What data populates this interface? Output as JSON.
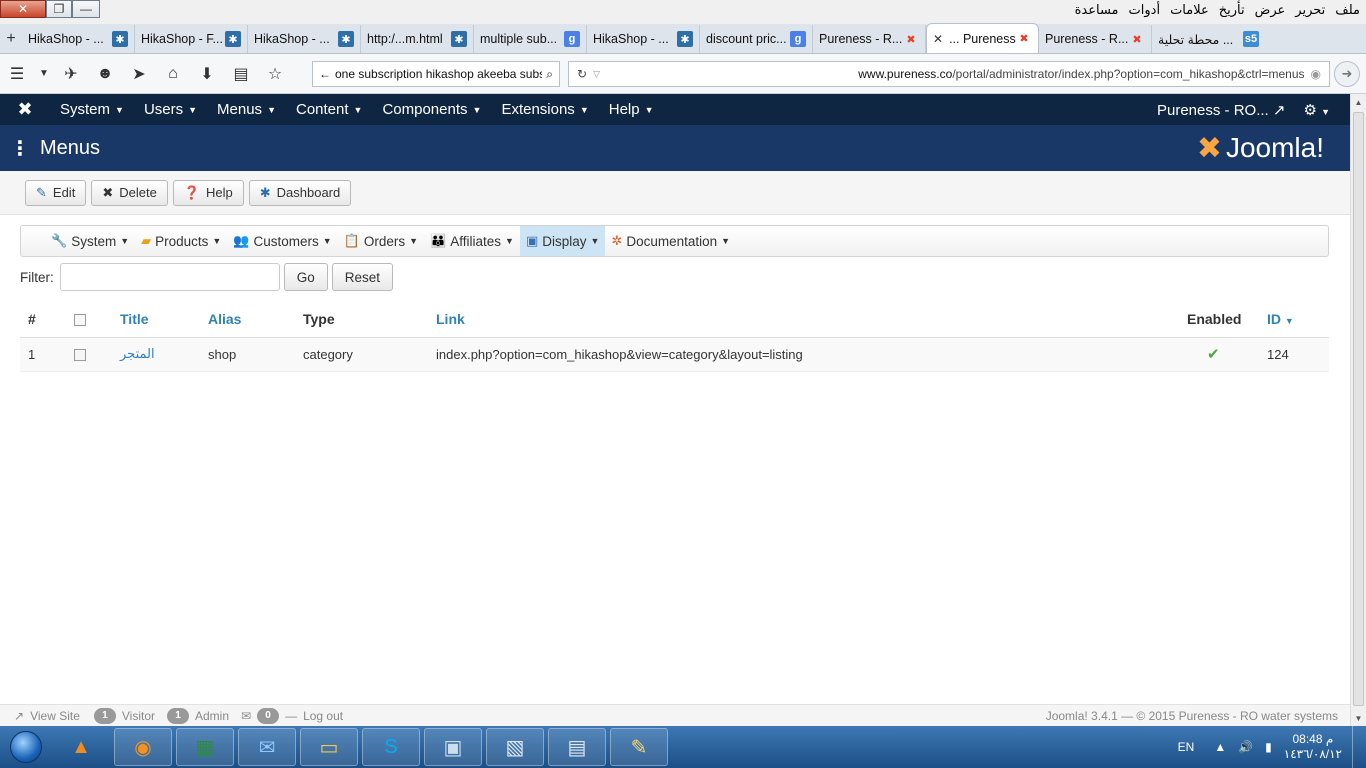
{
  "browser": {
    "menu_items_ar": [
      "ملف",
      "تحرير",
      "عرض",
      "تأريخ",
      "علامات",
      "أدوات",
      "مساعدة"
    ],
    "tabs": [
      {
        "label": "HikaShop - ...",
        "icon": "hikashop-icon"
      },
      {
        "label": "HikaShop - F...",
        "icon": "hikashop-icon"
      },
      {
        "label": "HikaShop - ...",
        "icon": "hikashop-icon"
      },
      {
        "label": "http:/...m.html",
        "icon": "hikashop-icon"
      },
      {
        "label": "multiple sub...",
        "icon": "google-icon"
      },
      {
        "label": "HikaShop - ...",
        "icon": "hikashop-icon"
      },
      {
        "label": "discount pric...",
        "icon": "google-icon"
      },
      {
        "label": "Pureness - R...",
        "icon": "joomla-icon"
      },
      {
        "label": "... Pureness",
        "icon": "joomla-icon",
        "active": true
      },
      {
        "label": "Pureness - R...",
        "icon": "joomla-icon"
      },
      {
        "label": "محطة تحلية ...",
        "icon": "s5-icon"
      }
    ],
    "search_value": "one subscription hikashop akeeba subs",
    "url_host": "www.pureness.co",
    "url_path": "/portal/administrator/index.php?option=com_hikashop&ctrl=menus"
  },
  "joomla": {
    "nav": [
      "System",
      "Users",
      "Menus",
      "Content",
      "Components",
      "Extensions",
      "Help"
    ],
    "site_name": "Pureness - RO...",
    "page_title": "Menus",
    "brand": "Joomla!",
    "toolbar": {
      "edit": "Edit",
      "delete": "Delete",
      "help": "Help",
      "dashboard": "Dashboard"
    },
    "hikamenu": [
      {
        "label": "System",
        "icon": "wrench-icon"
      },
      {
        "label": "Products",
        "icon": "box-icon"
      },
      {
        "label": "Customers",
        "icon": "users-icon"
      },
      {
        "label": "Orders",
        "icon": "orders-icon"
      },
      {
        "label": "Affiliates",
        "icon": "affiliates-icon"
      },
      {
        "label": "Display",
        "icon": "display-icon",
        "active": true
      },
      {
        "label": "Documentation",
        "icon": "lifebuoy-icon"
      }
    ],
    "filter": {
      "label": "Filter:",
      "value": "",
      "go": "Go",
      "reset": "Reset"
    },
    "table": {
      "headers": {
        "num": "#",
        "title": "Title",
        "alias": "Alias",
        "type": "Type",
        "link": "Link",
        "enabled": "Enabled",
        "id": "ID"
      },
      "rows": [
        {
          "num": "1",
          "title": "المتجر",
          "alias": "shop",
          "type": "category",
          "link": "index.php?option=com_hikashop&view=category&layout=listing",
          "enabled": true,
          "id": "124"
        }
      ]
    },
    "footer": {
      "view_site": "View Site",
      "visitors_count": "1",
      "visitors_label": "Visitor",
      "admins_count": "1",
      "admins_label": "Admin",
      "messages_count": "0",
      "logout": "Log out",
      "version": "Joomla! 3.4.1 — © 2015 Pureness - RO water systems"
    }
  },
  "taskbar": {
    "lang": "EN",
    "time": "08:48 م",
    "date": "١٤٣٦/٠٨/١٢"
  }
}
